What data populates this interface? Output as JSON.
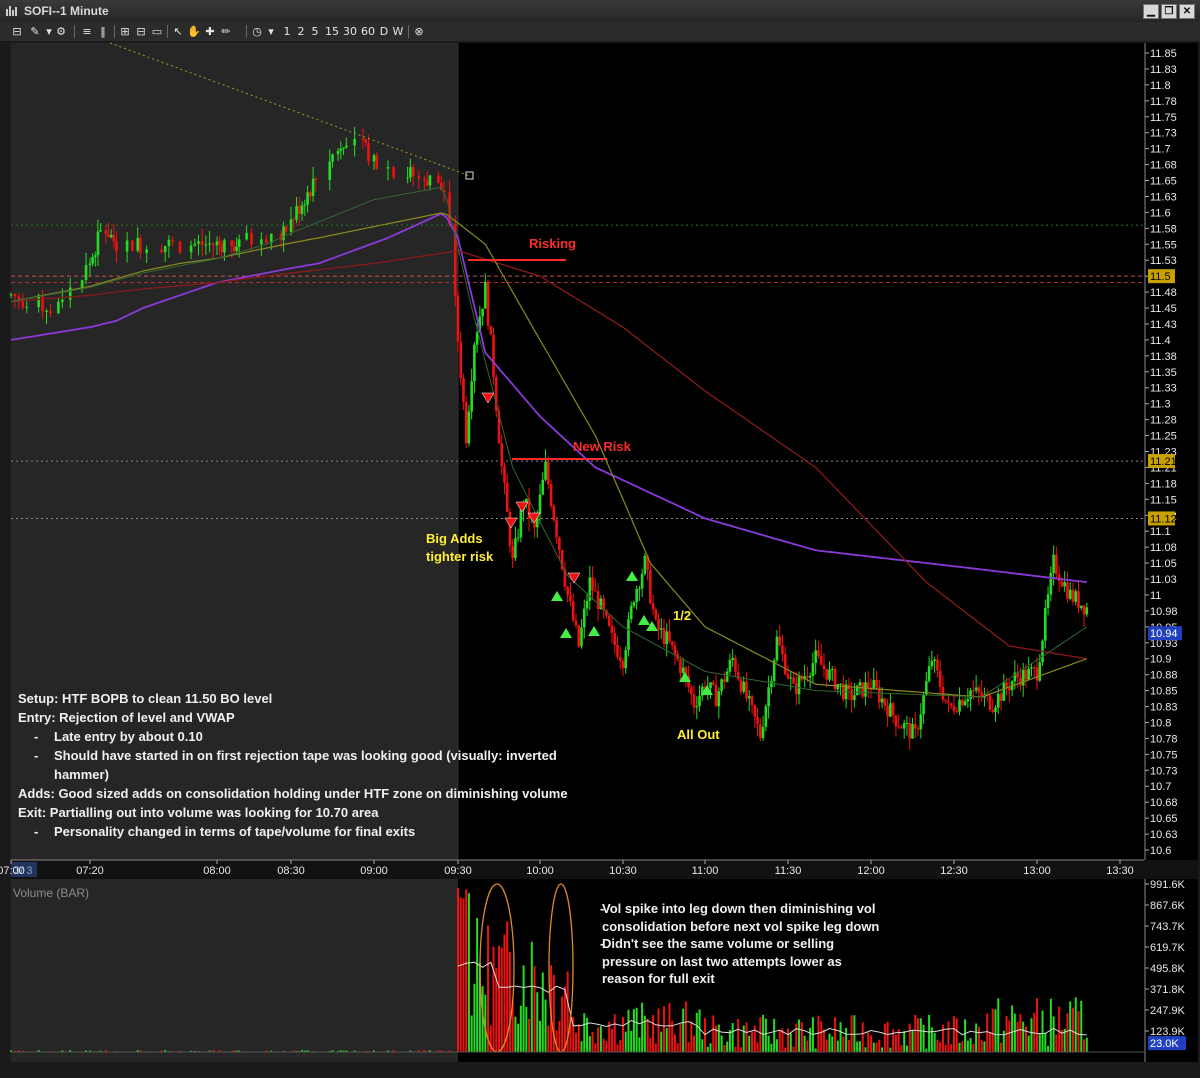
{
  "window": {
    "title": "SOFI--1 Minute",
    "buttons": {
      "minimize": "▁",
      "restore": "❐",
      "close": "✕"
    }
  },
  "toolbar": {
    "left_icons": [
      "chart-type-icon",
      "draw-tools-icon",
      "dropdown-icon",
      "lines-icon",
      "bars-icon",
      "grid-icon",
      "split-icon",
      "cursor-icon",
      "hand-icon",
      "crosshair-icon",
      "pencil-icon",
      "clock-icon",
      "dropdown-icon"
    ],
    "intervals": [
      "1",
      "2",
      "5",
      "15",
      "30",
      "60",
      "D",
      "W"
    ],
    "close_icon": "link-icon"
  },
  "price_axis": {
    "ticks": [
      "11.85",
      "11.83",
      "11.8",
      "11.78",
      "11.75",
      "11.73",
      "11.7",
      "11.68",
      "11.65",
      "11.63",
      "11.6",
      "11.58",
      "11.55",
      "11.53",
      "11.5",
      "11.48",
      "11.45",
      "11.43",
      "11.4",
      "11.38",
      "11.35",
      "11.33",
      "11.3",
      "11.28",
      "11.25",
      "11.23",
      "11.21",
      "11.18",
      "11.15",
      "11.12",
      "11.1",
      "11.08",
      "11.05",
      "11.03",
      "11",
      "10.98",
      "10.95",
      "10.93",
      "10.9",
      "10.88",
      "10.85",
      "10.83",
      "10.8",
      "10.78",
      "10.75",
      "10.73",
      "10.7",
      "10.68",
      "10.65",
      "10.63",
      "10.6"
    ],
    "highlighted_levels": [
      "11.5",
      "11.21",
      "11.12"
    ],
    "current_price": "10.94"
  },
  "time_axis": {
    "date_label": "3/ 3",
    "ticks": [
      "07:00",
      "07:20",
      "08:00",
      "08:30",
      "09:00",
      "09:30",
      "10:00",
      "10:30",
      "11:00",
      "11:30",
      "12:00",
      "12:30",
      "13:00",
      "13:30"
    ]
  },
  "volume_panel": {
    "title": "Volume (BAR)",
    "ticks": [
      "991.6K",
      "867.6K",
      "743.7K",
      "619.7K",
      "495.8K",
      "371.8K",
      "247.9K",
      "123.9K"
    ],
    "current": "23.0K"
  },
  "annotations": {
    "risking": "Risking",
    "new_risk": "New Risk",
    "big_adds_1": "Big Adds",
    "big_adds_2": "tighter risk",
    "half": "1/2",
    "all_out": "All Out"
  },
  "trade_notes": {
    "setup": "Setup: HTF BOPB to clean 11.50 BO level",
    "entry": "Entry: Rejection of level and VWAP",
    "entry_sub1": "Late entry by about 0.10",
    "entry_sub2": "Should have started in on first rejection tape was looking good (visually: inverted hammer)",
    "adds": "Adds: Good sized adds on consolidation holding under HTF zone on diminishing volume",
    "exit": "Exit: Partialling out into volume was looking for 10.70 area",
    "exit_sub1": "Personality changed in terms of tape/volume for final exits"
  },
  "volume_notes": {
    "note1": "Vol spike into leg down then diminishing vol consolidation before next vol spike leg down",
    "note2": "Didn't see the same volume or selling pressure on last two attempts lower as reason for full exit"
  },
  "colors": {
    "up_candle": "#22dd22",
    "down_candle": "#ee1111",
    "vwap": "#8a3ad8",
    "premarket_bg": "#262626",
    "annotation_red": "#ff2a2a",
    "annotation_yellow": "#ffee33"
  }
}
